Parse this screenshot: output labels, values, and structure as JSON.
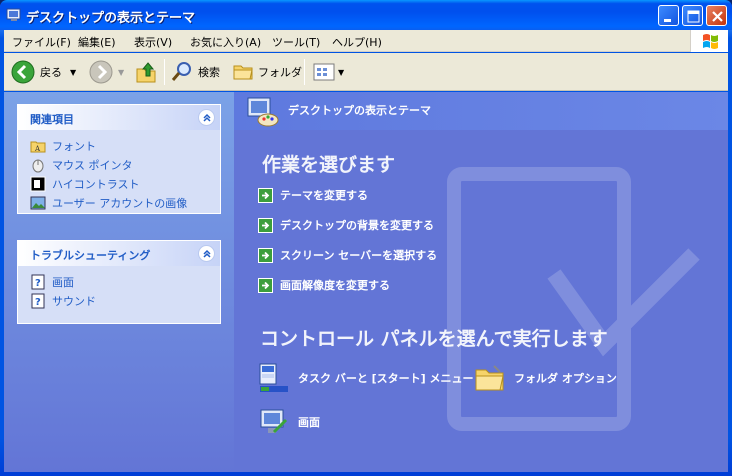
{
  "window": {
    "title": "デスクトップの表示とテーマ",
    "controls": [
      "minimize",
      "maximize",
      "close"
    ]
  },
  "menu": {
    "items": [
      "ファイル(F)",
      "編集(E)",
      "表示(V)",
      "お気に入り(A)",
      "ツール(T)",
      "ヘルプ(H)"
    ]
  },
  "toolbar": {
    "back_label": "戻る",
    "search_label": "検索",
    "folders_label": "フォルダ"
  },
  "left": {
    "related": {
      "title": "関連項目",
      "links": [
        "フォント",
        "マウス ポインタ",
        "ハイコントラスト",
        "ユーザー アカウントの画像"
      ]
    },
    "troubleshoot": {
      "title": "トラブルシューティング",
      "links": [
        "画面",
        "サウンド"
      ]
    }
  },
  "main": {
    "header_title": "デスクトップの表示とテーマ",
    "pick_task_heading": "作業を選びます",
    "tasks": [
      "テーマを変更する",
      "デスクトップの背景を変更する",
      "スクリーン セーバーを選択する",
      "画面解像度を変更する"
    ],
    "pick_cp_heading": "コントロール パネルを選んで実行します",
    "cp_items": [
      "タスク バーと [スタート] メニュー",
      "フォルダ オプション",
      "画面"
    ]
  },
  "colors": {
    "link": "#215dc6",
    "pane_bg": "#6375d6",
    "title_bar": "#0054e3",
    "task_arrow": "#3c9e3c"
  }
}
